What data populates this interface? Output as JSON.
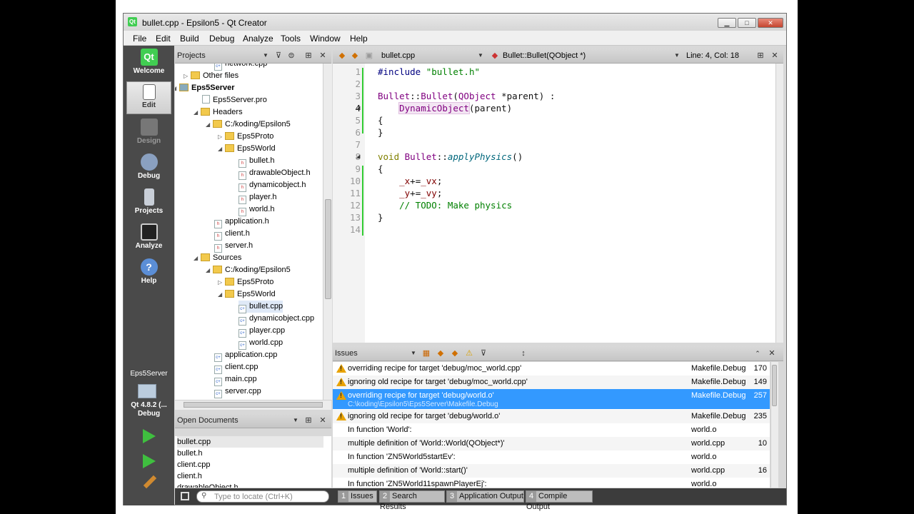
{
  "window": {
    "title": "bullet.cpp - Epsilon5 - Qt Creator"
  },
  "menu": [
    "File",
    "Edit",
    "Build",
    "Debug",
    "Analyze",
    "Tools",
    "Window",
    "Help"
  ],
  "modes": [
    {
      "label": "Welcome",
      "icon": "qt-logo-icon"
    },
    {
      "label": "Edit",
      "icon": "edit-document-icon"
    },
    {
      "label": "Design",
      "icon": "design-tools-icon"
    },
    {
      "label": "Debug",
      "icon": "debug-bug-icon"
    },
    {
      "label": "Projects",
      "icon": "projects-icon"
    },
    {
      "label": "Analyze",
      "icon": "analyze-icon"
    },
    {
      "label": "Help",
      "icon": "help-icon"
    }
  ],
  "target": {
    "project": "Eps5Server",
    "kit": "Qt 4.8.2 (...",
    "config": "Debug"
  },
  "projects_panel": {
    "title": "Projects",
    "tree": [
      {
        "label": "network.cpp",
        "type": "cpp"
      },
      {
        "label": "Other files",
        "type": "folder",
        "arrow": "▷"
      },
      {
        "label": "Eps5Server",
        "type": "project",
        "arrow": "◢",
        "bold": true
      },
      {
        "label": "Eps5Server.pro",
        "type": "pro"
      },
      {
        "label": "Headers",
        "type": "folder",
        "arrow": "◢"
      },
      {
        "label": "C:/koding/Epsilon5",
        "type": "folder",
        "arrow": "◢"
      },
      {
        "label": "Eps5Proto",
        "type": "folder",
        "arrow": "▷"
      },
      {
        "label": "Eps5World",
        "type": "folder",
        "arrow": "◢"
      },
      {
        "label": "bullet.h",
        "type": "h"
      },
      {
        "label": "drawableObject.h",
        "type": "h"
      },
      {
        "label": "dynamicobject.h",
        "type": "h"
      },
      {
        "label": "player.h",
        "type": "h"
      },
      {
        "label": "world.h",
        "type": "h"
      },
      {
        "label": "application.h",
        "type": "h"
      },
      {
        "label": "client.h",
        "type": "h"
      },
      {
        "label": "server.h",
        "type": "h"
      },
      {
        "label": "Sources",
        "type": "folder",
        "arrow": "◢"
      },
      {
        "label": "C:/koding/Epsilon5",
        "type": "folder",
        "arrow": "◢"
      },
      {
        "label": "Eps5Proto",
        "type": "folder",
        "arrow": "▷"
      },
      {
        "label": "Eps5World",
        "type": "folder",
        "arrow": "◢"
      },
      {
        "label": "bullet.cpp",
        "type": "cpp",
        "selected": true
      },
      {
        "label": "dynamicobject.cpp",
        "type": "cpp"
      },
      {
        "label": "player.cpp",
        "type": "cpp"
      },
      {
        "label": "world.cpp",
        "type": "cpp"
      },
      {
        "label": "application.cpp",
        "type": "cpp"
      },
      {
        "label": "client.cpp",
        "type": "cpp"
      },
      {
        "label": "main.cpp",
        "type": "cpp"
      },
      {
        "label": "server.cpp",
        "type": "cpp"
      }
    ]
  },
  "open_documents": {
    "title": "Open Documents",
    "items": [
      "bullet.cpp",
      "bullet.h",
      "client.cpp",
      "client.h",
      "drawableObject.h"
    ]
  },
  "editor": {
    "file": "bullet.cpp",
    "symbol": "Bullet::Bullet(QObject *)",
    "position": "Line: 4, Col: 18",
    "line_numbers": [
      "1",
      "2",
      "3",
      "4",
      "5",
      "6",
      "7",
      "8",
      "9",
      "10",
      "11",
      "12",
      "13",
      "14"
    ],
    "code": {
      "l1_pp": "#include ",
      "l1_str": "\"bullet.h\"",
      "l3_a": "Bullet",
      "l3_b": "::",
      "l3_c": "Bullet",
      "l3_d": "(",
      "l3_e": "QObject",
      "l3_f": " *parent) :",
      "l4_a": "    ",
      "l4_b": "DynamicObject",
      "l4_c": "(parent)",
      "l5": "{",
      "l6": "}",
      "l8_kw": "void ",
      "l8_cls": "Bullet",
      "l8_sep": "::",
      "l8_fn": "applyPhysics",
      "l8_end": "()",
      "l9": "{",
      "l10_a": "    ",
      "l10_b": "_x",
      "l10_c": "+=",
      "l10_d": "_vx",
      "l10_e": ";",
      "l11_a": "    ",
      "l11_b": "_y",
      "l11_c": "+=",
      "l11_d": "_vy",
      "l11_e": ";",
      "l12": "    // TODO: Make physics",
      "l13": "}"
    }
  },
  "issues": {
    "title": "Issues",
    "rows": [
      {
        "text": "overriding recipe for target 'debug/moc_world.cpp'",
        "file": "Makefile.Debug",
        "line": "170",
        "warn": true
      },
      {
        "text": "ignoring old recipe for target 'debug/moc_world.cpp'",
        "file": "Makefile.Debug",
        "line": "149",
        "warn": true
      },
      {
        "text": "overriding recipe for target 'debug/world.o'",
        "path": "C:\\koding\\Epsilon5\\Eps5Server\\Makefile.Debug",
        "file": "Makefile.Debug",
        "line": "257",
        "warn": true,
        "selected": true
      },
      {
        "text": "ignoring old recipe for target 'debug/world.o'",
        "file": "Makefile.Debug",
        "line": "235",
        "warn": true
      },
      {
        "text": "In function 'World':",
        "file": "world.o",
        "line": "",
        "warn": false
      },
      {
        "text": "multiple definition of 'World::World(QObject*)'",
        "file": "world.cpp",
        "line": "10",
        "warn": false
      },
      {
        "text": "In function 'ZN5World5startEv':",
        "file": "world.o",
        "line": "",
        "warn": false
      },
      {
        "text": "multiple definition of 'World::start()'",
        "file": "world.cpp",
        "line": "16",
        "warn": false
      },
      {
        "text": "In function 'ZN5World11spawnPlayerEj':",
        "file": "world.o",
        "line": "",
        "warn": false
      }
    ]
  },
  "statusbar": {
    "locator_placeholder": "Type to locate (Ctrl+K)",
    "tabs": [
      {
        "n": "1",
        "label": "Issues"
      },
      {
        "n": "2",
        "label": "Search Results"
      },
      {
        "n": "3",
        "label": "Application Output"
      },
      {
        "n": "4",
        "label": "Compile Output"
      }
    ]
  }
}
